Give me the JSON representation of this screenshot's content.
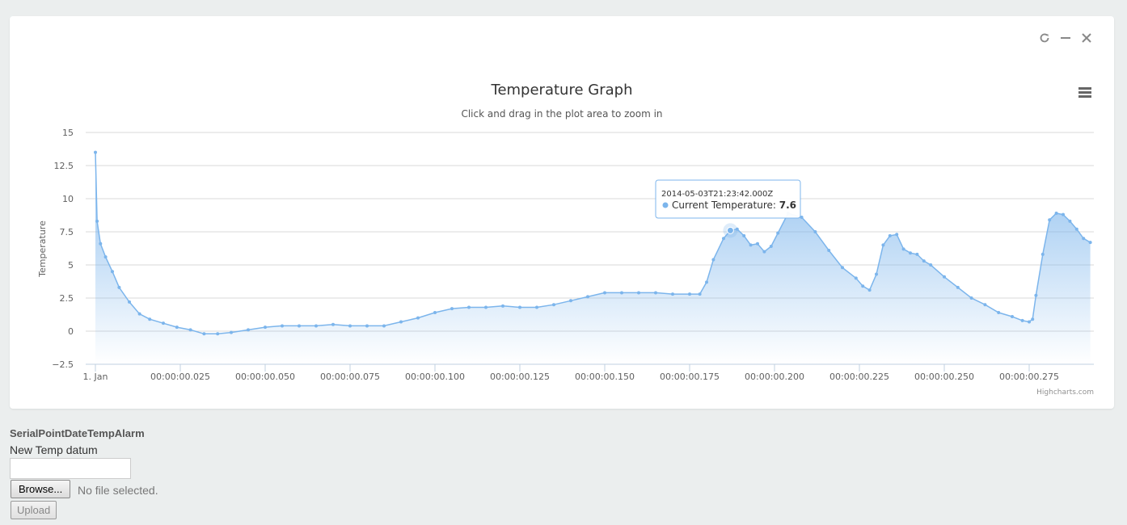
{
  "panel": {
    "tools": [
      {
        "icon": "refresh-icon"
      },
      {
        "icon": "minimize-icon"
      },
      {
        "icon": "close-icon"
      }
    ],
    "menu_icon": "hamburger-menu-icon"
  },
  "chart_data": {
    "type": "area",
    "title": "Temperature Graph",
    "subtitle": "Click and drag in the plot area to zoom in",
    "xlabel": "",
    "ylabel": "Temperature",
    "ylim": [
      -2.5,
      15
    ],
    "yticks": [
      "15",
      "12.5",
      "10",
      "7.5",
      "5",
      "2.5",
      "0",
      "−2.5"
    ],
    "ytick_values": [
      15,
      12.5,
      10,
      7.5,
      5,
      2.5,
      0,
      -2.5
    ],
    "xlim": [
      0,
      0.293
    ],
    "xticks": [
      "1. Jan",
      "00:00:00.025",
      "00:00:00.050",
      "00:00:00.075",
      "00:00:00.100",
      "00:00:00.125",
      "00:00:00.150",
      "00:00:00.175",
      "00:00:00.200",
      "00:00:00.225",
      "00:00:00.250",
      "00:00:00.275"
    ],
    "xtick_values": [
      0,
      0.025,
      0.05,
      0.075,
      0.1,
      0.125,
      0.15,
      0.175,
      0.2,
      0.225,
      0.25,
      0.275
    ],
    "grid": true,
    "legend": "none",
    "credits": "Highcharts.com",
    "color": "#7cb5ec",
    "series": [
      {
        "name": "Current Temperature",
        "x": [
          0,
          0.0005,
          0.0015,
          0.003,
          0.005,
          0.007,
          0.01,
          0.013,
          0.016,
          0.02,
          0.024,
          0.028,
          0.032,
          0.036,
          0.04,
          0.045,
          0.05,
          0.055,
          0.06,
          0.065,
          0.07,
          0.075,
          0.08,
          0.085,
          0.09,
          0.095,
          0.1,
          0.105,
          0.11,
          0.115,
          0.12,
          0.125,
          0.13,
          0.135,
          0.14,
          0.145,
          0.15,
          0.155,
          0.16,
          0.165,
          0.17,
          0.175,
          0.178,
          0.18,
          0.182,
          0.185,
          0.187,
          0.189,
          0.191,
          0.193,
          0.195,
          0.197,
          0.199,
          0.201,
          0.204,
          0.208,
          0.212,
          0.216,
          0.22,
          0.224,
          0.226,
          0.228,
          0.23,
          0.232,
          0.234,
          0.236,
          0.238,
          0.24,
          0.242,
          0.244,
          0.246,
          0.25,
          0.254,
          0.258,
          0.262,
          0.266,
          0.27,
          0.273,
          0.275,
          0.276,
          0.277,
          0.279,
          0.281,
          0.283,
          0.285,
          0.287,
          0.289,
          0.291,
          0.293
        ],
        "y": [
          13.5,
          8.3,
          6.6,
          5.6,
          4.5,
          3.3,
          2.2,
          1.3,
          0.9,
          0.6,
          0.3,
          0.1,
          -0.2,
          -0.2,
          -0.1,
          0.1,
          0.3,
          0.4,
          0.4,
          0.4,
          0.5,
          0.4,
          0.4,
          0.4,
          0.7,
          1.0,
          1.4,
          1.7,
          1.8,
          1.8,
          1.9,
          1.8,
          1.8,
          2.0,
          2.3,
          2.6,
          2.9,
          2.9,
          2.9,
          2.9,
          2.8,
          2.8,
          2.8,
          3.7,
          5.4,
          7.0,
          7.6,
          7.7,
          7.2,
          6.5,
          6.6,
          6.0,
          6.4,
          7.4,
          8.9,
          8.6,
          7.5,
          6.1,
          4.8,
          4.0,
          3.4,
          3.1,
          4.3,
          6.5,
          7.2,
          7.3,
          6.2,
          5.9,
          5.8,
          5.3,
          5.0,
          4.1,
          3.3,
          2.5,
          2.0,
          1.4,
          1.1,
          0.8,
          0.7,
          0.9,
          2.7,
          5.8,
          8.4,
          8.9,
          8.8,
          8.3,
          7.7,
          7.0,
          6.7
        ]
      }
    ],
    "tooltip": {
      "timestamp": "2014-05-03T21:23:42.000Z",
      "series_name": "Current Temperature",
      "value_text": "7.6",
      "x": 0.187,
      "y": 7.6
    }
  },
  "form": {
    "title": "SerialPointDateTempAlarm",
    "field_label": "New Temp datum",
    "input_value": "",
    "browse_label": "Browse...",
    "file_status": "No file selected.",
    "upload_label": "Upload"
  }
}
